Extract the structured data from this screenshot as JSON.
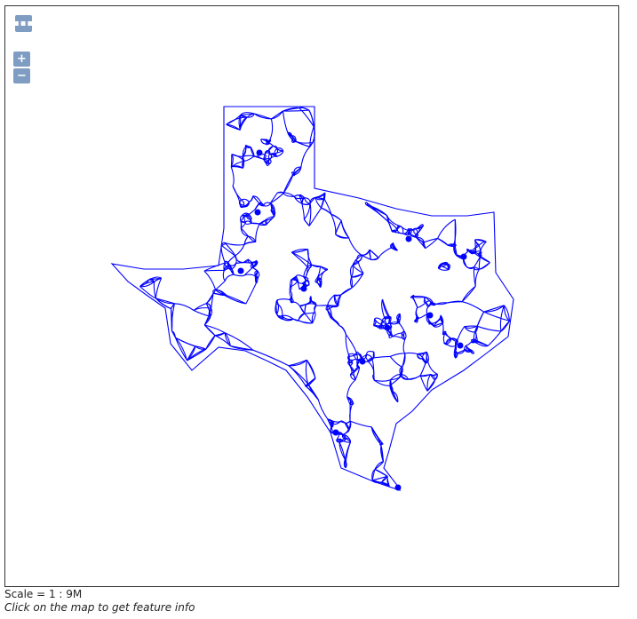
{
  "controls": {
    "layers_label": "▪▪▪",
    "zoom_in_label": "+",
    "zoom_out_label": "−"
  },
  "footer": {
    "scale_text": "Scale = 1 : 9M",
    "hint_text": "Click on the map to get feature info"
  },
  "map": {
    "road_color": "#0000ff",
    "background": "#ffffff",
    "feature": "Texas road network"
  }
}
